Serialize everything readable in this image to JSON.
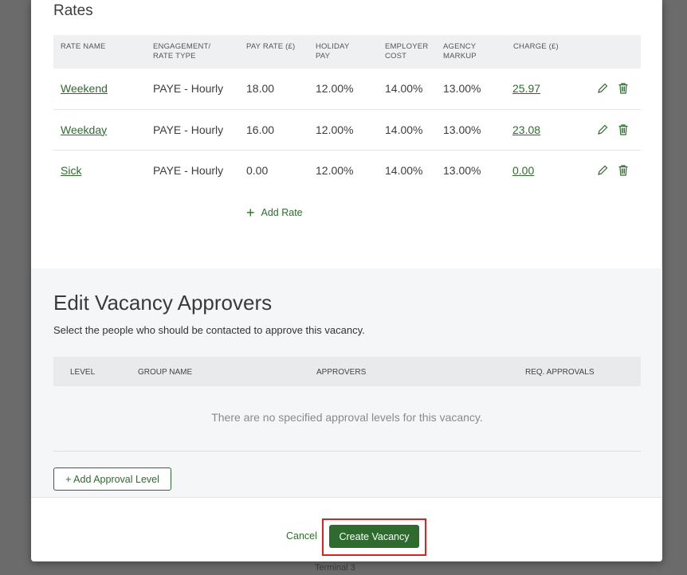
{
  "rates": {
    "title": "Rates",
    "columns": [
      "RATE NAME",
      "ENGAGEMENT/\nRATE TYPE",
      "PAY RATE (£)",
      "HOLIDAY\nPAY",
      "EMPLOYER\nCOST",
      "AGENCY\nMARKUP",
      "CHARGE (£)"
    ],
    "rows": [
      {
        "name": "Weekend",
        "type": "PAYE - Hourly",
        "pay_rate": "18.00",
        "holiday_pay": "12.00%",
        "employer_cost": "14.00%",
        "agency_markup": "13.00%",
        "charge": "25.97"
      },
      {
        "name": "Weekday",
        "type": "PAYE - Hourly",
        "pay_rate": "16.00",
        "holiday_pay": "12.00%",
        "employer_cost": "14.00%",
        "agency_markup": "13.00%",
        "charge": "23.08"
      },
      {
        "name": "Sick",
        "type": "PAYE - Hourly",
        "pay_rate": "0.00",
        "holiday_pay": "12.00%",
        "employer_cost": "14.00%",
        "agency_markup": "13.00%",
        "charge": "0.00"
      }
    ],
    "add_rate_label": "Add Rate",
    "icons": {
      "edit": "pencil-icon",
      "delete": "trash-icon",
      "add": "plus-icon"
    }
  },
  "approvers": {
    "title": "Edit Vacancy Approvers",
    "subtitle": "Select the people who should be contacted to approve this vacancy.",
    "columns": [
      "LEVEL",
      "GROUP NAME",
      "APPROVERS",
      "REQ. APPROVALS"
    ],
    "empty_message": "There are no specified approval levels for this vacancy.",
    "add_level_label": "+ Add Approval Level"
  },
  "footer": {
    "cancel_label": "Cancel",
    "create_label": "Create Vacancy"
  },
  "background": {
    "terminal_text": "Terminal 3"
  },
  "colors": {
    "accent": "#2f6b2f",
    "highlight": "#d9241c"
  }
}
